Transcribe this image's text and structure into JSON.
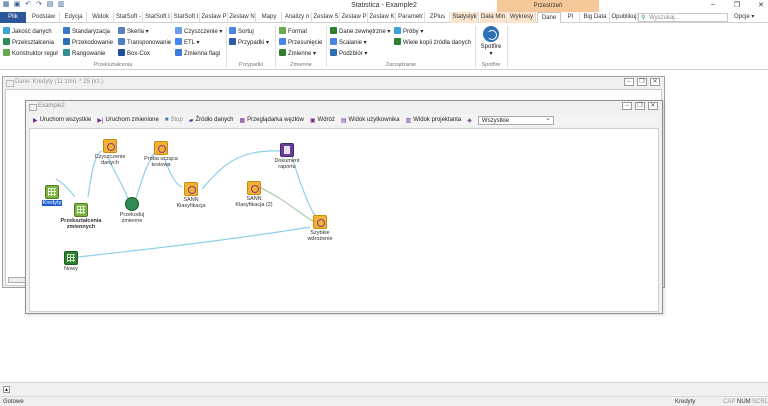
{
  "app": {
    "title": "Statistica - Example2",
    "context_group": "Przestrzeń"
  },
  "tabs": [
    {
      "label": "Plik"
    },
    {
      "label": "Podstaw"
    },
    {
      "label": "Edycja"
    },
    {
      "label": "Widok"
    },
    {
      "label": "StatSoft -"
    },
    {
      "label": "StatSoft I"
    },
    {
      "label": "StatSoft I"
    },
    {
      "label": "Zestaw P"
    },
    {
      "label": "Zestaw N"
    },
    {
      "label": "Mapy"
    },
    {
      "label": "Analizy n"
    },
    {
      "label": "Zestaw S"
    },
    {
      "label": "Zestaw P"
    },
    {
      "label": "Zestaw K"
    },
    {
      "label": "Parametr"
    },
    {
      "label": "ZPlus"
    },
    {
      "label": "Statystyk"
    },
    {
      "label": "Data Min"
    },
    {
      "label": "Wykresy"
    },
    {
      "label": "Dane"
    },
    {
      "label": "PI"
    },
    {
      "label": "Big Data"
    },
    {
      "label": "Opublikuj"
    }
  ],
  "search": {
    "placeholder": "Wyszukaj...",
    "options_label": "Opcje"
  },
  "ribbon": {
    "col1": [
      "Jakość danych",
      "Przekształcenia",
      "Konstruktor reguł"
    ],
    "col2": [
      "Standaryzacja",
      "Przekodowanie",
      "Rangowanie"
    ],
    "col3": [
      "Skerla",
      "Transponowanie",
      "Box-Cox"
    ],
    "col4": [
      "Czyszczenie",
      "ETL",
      "Zmienna flagi"
    ],
    "col5": [
      "Sortuj",
      "Przypadki"
    ],
    "col6": [
      "Format",
      "Przesunięcie",
      "Zmienne"
    ],
    "col7": [
      "Dane zewnętrzne",
      "Scalanie",
      "Podzbiór"
    ],
    "col8": [
      "Próby",
      "Wiele kopii źródła danych"
    ],
    "spotfire": "Spotfire",
    "groups": [
      "Przekształcenia",
      "Przypadki",
      "Zmienne",
      "Zarządzanie",
      "Spotfire"
    ]
  },
  "back_window": {
    "title": "Dane: Kredyty (11 zmn. * 25 prz.)"
  },
  "front_window": {
    "title": "Example2"
  },
  "toolbar": {
    "run_all": "Uruchom wszystkie",
    "run_changed": "Uruchom zmienione",
    "stop": "Stop",
    "data_source": "Źródło danych",
    "node_browser": "Przeglądarka węzłów",
    "deploy": "Wdróż",
    "user_view": "Widok użytkownika",
    "designer_view": "Widok projektanta",
    "filter_value": "Wszystkie"
  },
  "nodes": {
    "kredyty": "Kredyty",
    "przeksztalcenia": "Przekształcenia zmiennych",
    "czyszczenie": "Czyszczenie danych",
    "przekoduj": "Przekoduj zmienne",
    "proba": "Próba ucząca testowa",
    "sann1": "SANN Klasyfikacja",
    "sann2": "SANN Klasyfikacja (2)",
    "raport": "Dokument raportu",
    "wdrozenie": "Szybkie wdrożenie",
    "nowy": "Nowy"
  },
  "status": {
    "left": "Gotowe",
    "middle": "Kredyty",
    "cap": "CAP",
    "num": "NUM",
    "scrl": "SCRL"
  }
}
